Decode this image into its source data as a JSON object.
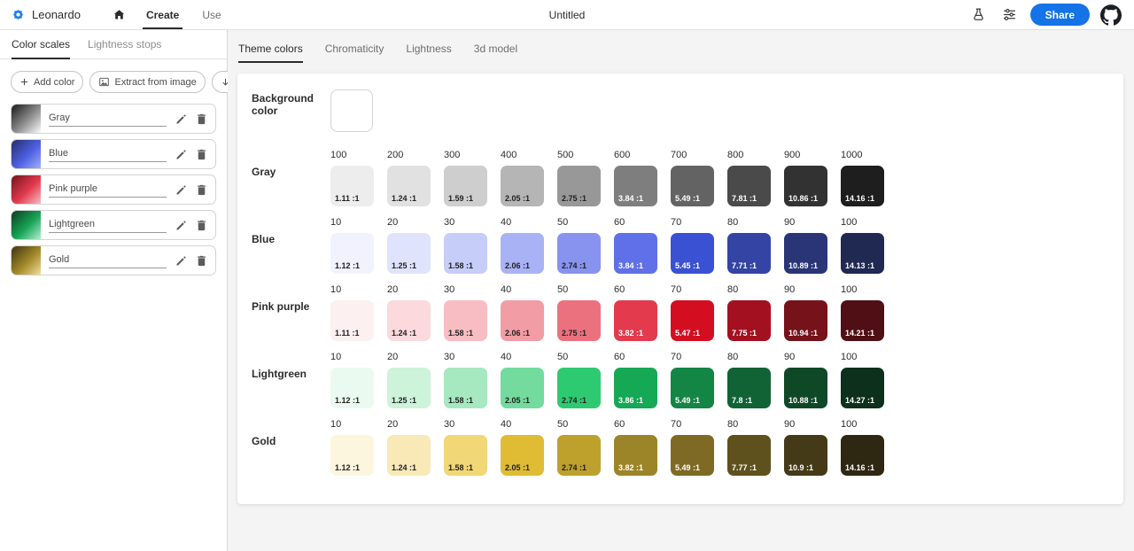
{
  "topbar": {
    "brand": "Leonardo",
    "nav": {
      "create": "Create",
      "use": "Use"
    },
    "document_title": "Untitled",
    "actions": {
      "share": "Share"
    },
    "accent_color": "#1473e6"
  },
  "sidebar": {
    "tabs": {
      "color_scales": "Color scales",
      "lightness_stops": "Lightness stops"
    },
    "actions": {
      "add_color": "Add color",
      "extract_from_image": "Extract from image",
      "sort": "Sort"
    },
    "color_scales": [
      {
        "name": "Gray",
        "gradient": [
          "#161616",
          "#8f8f8f",
          "#ffffff"
        ]
      },
      {
        "name": "Blue",
        "gradient": [
          "#232c63",
          "#4d60e4",
          "#a7b1f4"
        ]
      },
      {
        "name": "Pink purple",
        "gradient": [
          "#6f1218",
          "#e23a4e",
          "#f7c3c9"
        ]
      },
      {
        "name": "Lightgreen",
        "gradient": [
          "#0d3a20",
          "#17a556",
          "#bdf0d4"
        ]
      },
      {
        "name": "Gold",
        "gradient": [
          "#3a3115",
          "#a38928",
          "#f4e3a1"
        ]
      }
    ]
  },
  "main": {
    "tabs": [
      "Theme colors",
      "Chromaticity",
      "Lightness",
      "3d model"
    ],
    "background_color": {
      "label": "Background color",
      "value": "#ffffff"
    },
    "rows": [
      {
        "name": "Gray",
        "swatches": [
          {
            "label": "100",
            "color": "#ededed",
            "ratio": "1.11 :1",
            "text": "#222222"
          },
          {
            "label": "200",
            "color": "#e1e1e1",
            "ratio": "1.24 :1",
            "text": "#222222"
          },
          {
            "label": "300",
            "color": "#cecece",
            "ratio": "1.59 :1",
            "text": "#222222"
          },
          {
            "label": "400",
            "color": "#b5b5b5",
            "ratio": "2.05 :1",
            "text": "#222222"
          },
          {
            "label": "500",
            "color": "#989898",
            "ratio": "2.75 :1",
            "text": "#222222"
          },
          {
            "label": "600",
            "color": "#7e7e7e",
            "ratio": "3.84 :1",
            "text": "#ffffff"
          },
          {
            "label": "700",
            "color": "#636363",
            "ratio": "5.49 :1",
            "text": "#ffffff"
          },
          {
            "label": "800",
            "color": "#4a4a4a",
            "ratio": "7.81 :1",
            "text": "#ffffff"
          },
          {
            "label": "900",
            "color": "#323232",
            "ratio": "10.86 :1",
            "text": "#ffffff"
          },
          {
            "label": "1000",
            "color": "#1e1e1e",
            "ratio": "14.16 :1",
            "text": "#ffffff"
          }
        ]
      },
      {
        "name": "Blue",
        "swatches": [
          {
            "label": "10",
            "color": "#f1f2fd",
            "ratio": "1.12 :1",
            "text": "#222222"
          },
          {
            "label": "20",
            "color": "#e0e3fc",
            "ratio": "1.25 :1",
            "text": "#222222"
          },
          {
            "label": "30",
            "color": "#c7cdf9",
            "ratio": "1.58 :1",
            "text": "#222222"
          },
          {
            "label": "40",
            "color": "#a9b2f5",
            "ratio": "2.06 :1",
            "text": "#222222"
          },
          {
            "label": "50",
            "color": "#8793ef",
            "ratio": "2.74 :1",
            "text": "#222222"
          },
          {
            "label": "60",
            "color": "#5f70e8",
            "ratio": "3.84 :1",
            "text": "#ffffff"
          },
          {
            "label": "70",
            "color": "#3b51d3",
            "ratio": "5.45 :1",
            "text": "#ffffff"
          },
          {
            "label": "80",
            "color": "#3444a4",
            "ratio": "7.71 :1",
            "text": "#ffffff"
          },
          {
            "label": "90",
            "color": "#2a3578",
            "ratio": "10.89 :1",
            "text": "#ffffff"
          },
          {
            "label": "100",
            "color": "#1f2952",
            "ratio": "14.13 :1",
            "text": "#ffffff"
          }
        ]
      },
      {
        "name": "Pink purple",
        "swatches": [
          {
            "label": "10",
            "color": "#fdf0f1",
            "ratio": "1.11 :1",
            "text": "#222222"
          },
          {
            "label": "20",
            "color": "#fbd9dd",
            "ratio": "1.24 :1",
            "text": "#222222"
          },
          {
            "label": "30",
            "color": "#f7bdc3",
            "ratio": "1.58 :1",
            "text": "#222222"
          },
          {
            "label": "40",
            "color": "#f29ca5",
            "ratio": "2.06 :1",
            "text": "#222222"
          },
          {
            "label": "50",
            "color": "#ec717e",
            "ratio": "2.75 :1",
            "text": "#222222"
          },
          {
            "label": "60",
            "color": "#e43a4e",
            "ratio": "3.82 :1",
            "text": "#ffffff"
          },
          {
            "label": "70",
            "color": "#d40e21",
            "ratio": "5.47 :1",
            "text": "#ffffff"
          },
          {
            "label": "80",
            "color": "#a31120",
            "ratio": "7.75 :1",
            "text": "#ffffff"
          },
          {
            "label": "90",
            "color": "#75121a",
            "ratio": "10.94 :1",
            "text": "#ffffff"
          },
          {
            "label": "100",
            "color": "#500f14",
            "ratio": "14.21 :1",
            "text": "#ffffff"
          }
        ]
      },
      {
        "name": "Lightgreen",
        "swatches": [
          {
            "label": "10",
            "color": "#eafaf1",
            "ratio": "1.12 :1",
            "text": "#222222"
          },
          {
            "label": "20",
            "color": "#cdf3db",
            "ratio": "1.25 :1",
            "text": "#222222"
          },
          {
            "label": "30",
            "color": "#a6e9c0",
            "ratio": "1.58 :1",
            "text": "#222222"
          },
          {
            "label": "40",
            "color": "#73db9d",
            "ratio": "2.05 :1",
            "text": "#222222"
          },
          {
            "label": "50",
            "color": "#2eca71",
            "ratio": "2.74 :1",
            "text": "#222222"
          },
          {
            "label": "60",
            "color": "#15a855",
            "ratio": "3.86 :1",
            "text": "#ffffff"
          },
          {
            "label": "70",
            "color": "#138545",
            "ratio": "5.49 :1",
            "text": "#ffffff"
          },
          {
            "label": "80",
            "color": "#116336",
            "ratio": "7.8 :1",
            "text": "#ffffff"
          },
          {
            "label": "90",
            "color": "#0f4827",
            "ratio": "10.88 :1",
            "text": "#ffffff"
          },
          {
            "label": "100",
            "color": "#0c301b",
            "ratio": "14.27 :1",
            "text": "#ffffff"
          }
        ]
      },
      {
        "name": "Gold",
        "swatches": [
          {
            "label": "10",
            "color": "#fcf6df",
            "ratio": "1.12 :1",
            "text": "#222222"
          },
          {
            "label": "20",
            "color": "#f8e9b7",
            "ratio": "1.24 :1",
            "text": "#222222"
          },
          {
            "label": "30",
            "color": "#f1d775",
            "ratio": "1.58 :1",
            "text": "#222222"
          },
          {
            "label": "40",
            "color": "#dfbc34",
            "ratio": "2.05 :1",
            "text": "#222222"
          },
          {
            "label": "50",
            "color": "#bea02d",
            "ratio": "2.74 :1",
            "text": "#222222"
          },
          {
            "label": "60",
            "color": "#9c8428",
            "ratio": "3.82 :1",
            "text": "#ffffff"
          },
          {
            "label": "70",
            "color": "#7e6a24",
            "ratio": "5.49 :1",
            "text": "#ffffff"
          },
          {
            "label": "80",
            "color": "#5f511e",
            "ratio": "7.77 :1",
            "text": "#ffffff"
          },
          {
            "label": "90",
            "color": "#453a18",
            "ratio": "10.9 :1",
            "text": "#ffffff"
          },
          {
            "label": "100",
            "color": "#2e2712",
            "ratio": "14.16 :1",
            "text": "#ffffff"
          }
        ]
      }
    ]
  }
}
